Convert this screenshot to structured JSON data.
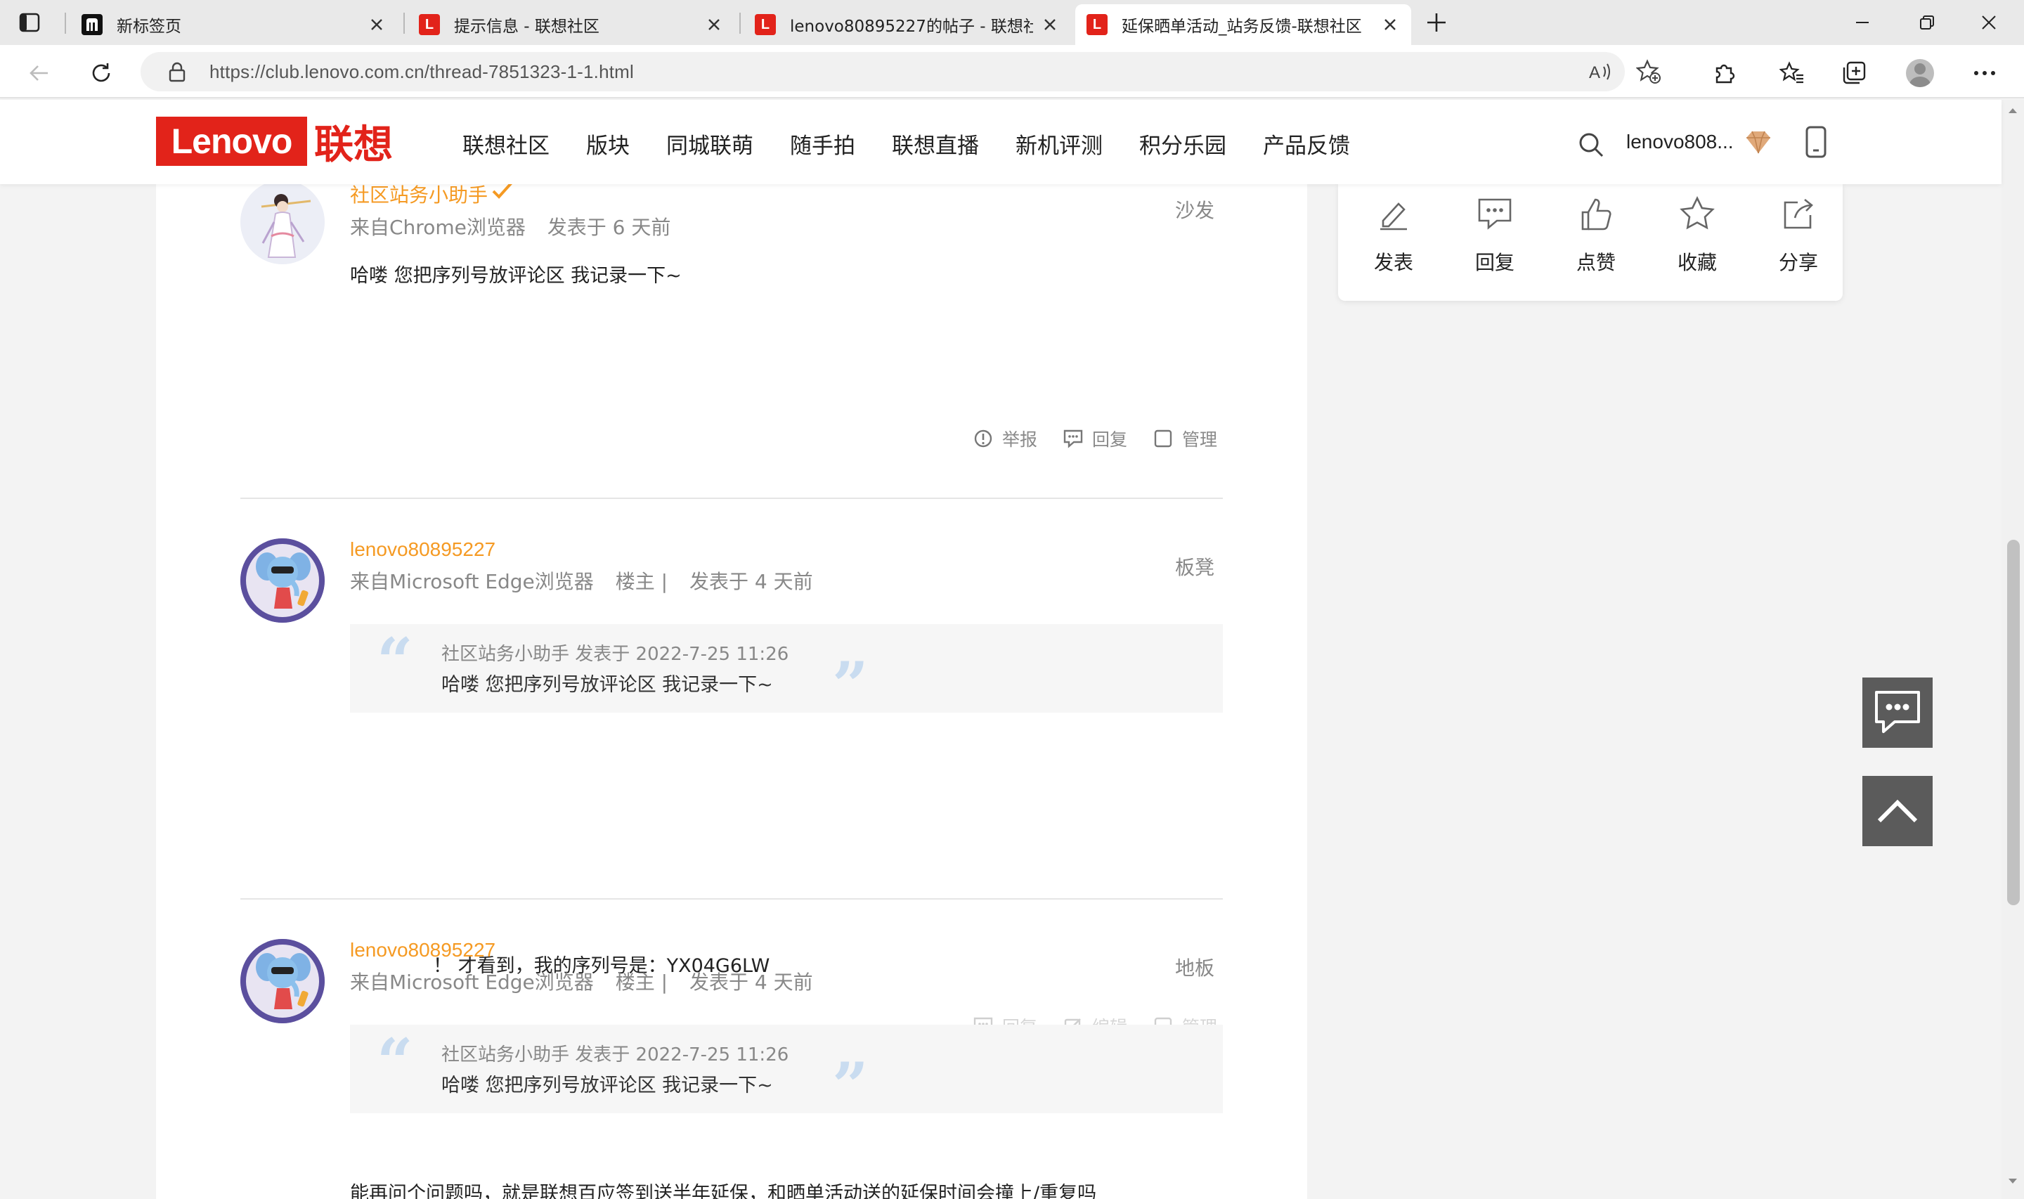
{
  "browser": {
    "tabs": [
      {
        "title": "新标签页",
        "favicon": "new-tab-icon",
        "active": false
      },
      {
        "title": "提示信息 - 联想社区",
        "favicon": "lenovo-favicon",
        "active": false
      },
      {
        "title": "lenovo80895227的帖子 - 联想社",
        "favicon": "lenovo-favicon",
        "active": false
      },
      {
        "title": "延保晒单活动_站务反馈-联想社区",
        "favicon": "lenovo-favicon",
        "active": true
      }
    ],
    "favicon_letter": "L",
    "url": "https://club.lenovo.com.cn/thread-7851323-1-1.html"
  },
  "site": {
    "logo_en": "Lenovo",
    "logo_cn": "联想",
    "nav": [
      "联想社区",
      "版块",
      "同城联萌",
      "随手拍",
      "联想直播",
      "新机评测",
      "积分乐园",
      "产品反馈"
    ],
    "username": "lenovo808...",
    "brand_color": "#e2231a",
    "author_color": "#f59a23"
  },
  "side_actions": [
    {
      "label": "发表",
      "icon": "compose-icon"
    },
    {
      "label": "回复",
      "icon": "comment-icon"
    },
    {
      "label": "点赞",
      "icon": "thumbs-up-icon"
    },
    {
      "label": "收藏",
      "icon": "star-icon"
    },
    {
      "label": "分享",
      "icon": "share-icon"
    }
  ],
  "posts": [
    {
      "author": "社区站务小助手",
      "meta": [
        "来自Chrome浏览器",
        "发表于 6 天前"
      ],
      "floor": "沙发",
      "body": "哈喽 您把序列号放评论区 我记录一下~",
      "actions": [
        "举报",
        "回复",
        "管理"
      ]
    },
    {
      "author": "lenovo80895227",
      "meta": [
        "来自Microsoft Edge浏览器",
        "楼主 |",
        "发表于 4 天前"
      ],
      "floor": "板凳",
      "quote_head": "社区站务小助手 发表于 2022-7-25 11:26",
      "quote_text": "哈喽 您把序列号放评论区 我记录一下~",
      "body": "！ 才看到，我的序列号是：YX04G6LW",
      "actions": [
        "回复",
        "编辑",
        "管理"
      ]
    },
    {
      "author": "lenovo80895227",
      "meta": [
        "来自Microsoft Edge浏览器",
        "楼主 |",
        "发表于 4 天前"
      ],
      "floor": "地板",
      "quote_head": "社区站务小助手 发表于 2022-7-25 11:26",
      "quote_text": "哈喽 您把序列号放评论区 我记录一下~",
      "body": "能再问个问题吗，就是联想百应签到送半年延保，和晒单活动送的延保时间会撞上/重复吗"
    }
  ]
}
